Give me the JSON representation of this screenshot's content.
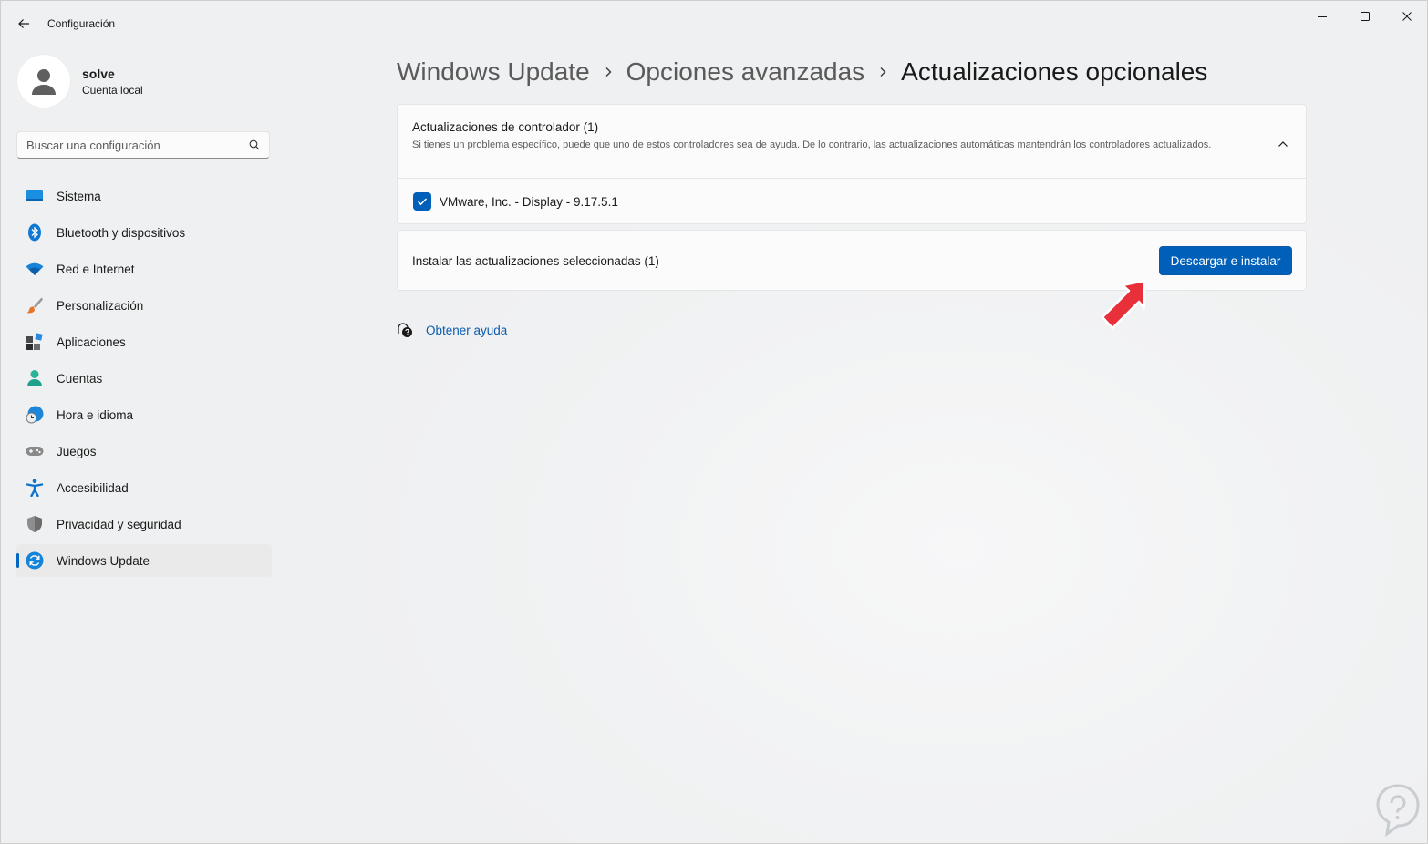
{
  "window": {
    "title": "Configuración",
    "controls": [
      "minimize",
      "maximize",
      "close"
    ]
  },
  "user": {
    "name": "solve",
    "account_type": "Cuenta local"
  },
  "search": {
    "placeholder": "Buscar una configuración",
    "value": ""
  },
  "sidebar": {
    "items": [
      {
        "label": "Sistema",
        "icon": "system-icon"
      },
      {
        "label": "Bluetooth y dispositivos",
        "icon": "bluetooth-icon"
      },
      {
        "label": "Red e Internet",
        "icon": "wifi-icon"
      },
      {
        "label": "Personalización",
        "icon": "brush-icon"
      },
      {
        "label": "Aplicaciones",
        "icon": "apps-icon"
      },
      {
        "label": "Cuentas",
        "icon": "accounts-icon"
      },
      {
        "label": "Hora e idioma",
        "icon": "time-language-icon"
      },
      {
        "label": "Juegos",
        "icon": "gamepad-icon"
      },
      {
        "label": "Accesibilidad",
        "icon": "accessibility-icon"
      },
      {
        "label": "Privacidad y seguridad",
        "icon": "shield-icon"
      },
      {
        "label": "Windows Update",
        "icon": "windows-update-icon",
        "selected": true
      }
    ]
  },
  "breadcrumb": {
    "items": [
      "Windows Update",
      "Opciones avanzadas",
      "Actualizaciones opcionales"
    ]
  },
  "driver_updates": {
    "title": "Actualizaciones de controlador (1)",
    "description": "Si tienes un problema específico, puede que uno de estos controladores sea de ayuda. De lo contrario, las actualizaciones automáticas mantendrán los controladores actualizados.",
    "expanded": true,
    "items": [
      {
        "label": "VMware, Inc. - Display - 9.17.5.1",
        "checked": true
      }
    ]
  },
  "install": {
    "label": "Instalar las actualizaciones seleccionadas (1)",
    "button_label": "Descargar e instalar"
  },
  "help": {
    "link_label": "Obtener ayuda"
  },
  "colors": {
    "accent": "#005fb8",
    "annotation_arrow": "#e8303a"
  }
}
